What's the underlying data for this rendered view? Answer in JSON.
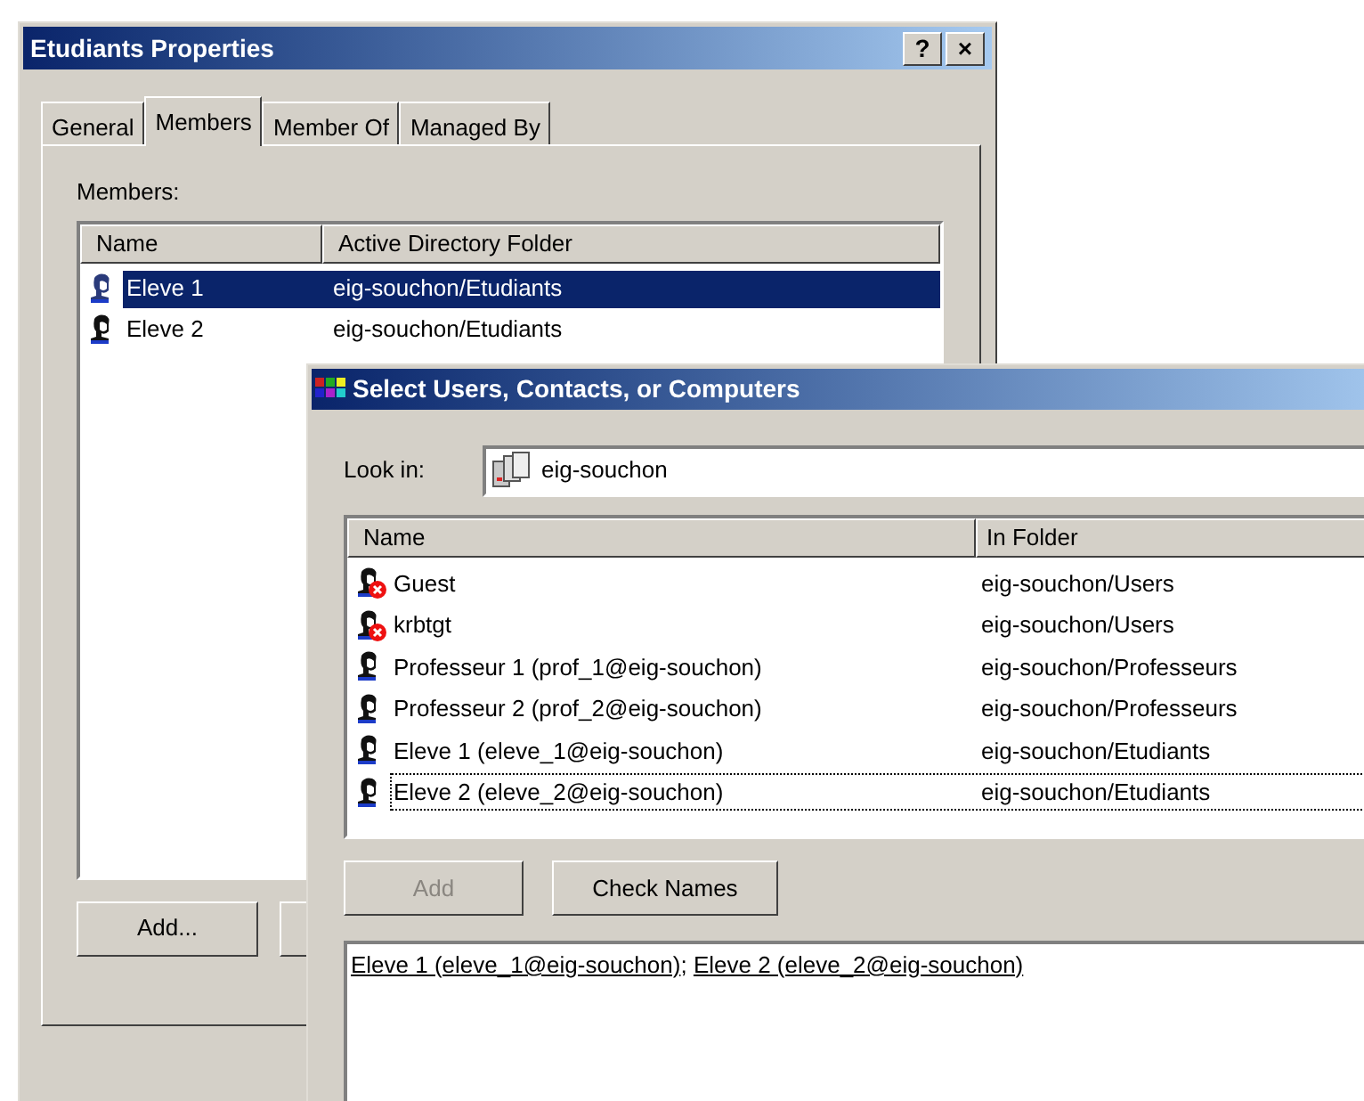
{
  "properties_window": {
    "title": "Etudiants Properties",
    "title_buttons": [
      "?",
      "×"
    ],
    "tabs": [
      {
        "label": "General",
        "selected": false
      },
      {
        "label": "Members",
        "selected": true
      },
      {
        "label": "Member Of",
        "selected": false
      },
      {
        "label": "Managed By",
        "selected": false
      }
    ],
    "members_label": "Members:",
    "columns": [
      "Name",
      "Active Directory Folder"
    ],
    "rows": [
      {
        "name": "Eleve 1",
        "folder": "eig-souchon/Etudiants",
        "kind": "user",
        "selected": true
      },
      {
        "name": "Eleve 2",
        "folder": "eig-souchon/Etudiants",
        "kind": "user",
        "selected": false
      }
    ],
    "buttons": [
      {
        "label": "Add...",
        "disabled": false
      }
    ]
  },
  "select_dialog": {
    "title": "Select Users, Contacts, or Computers",
    "look_in_label": "Look in:",
    "look_in_value": "eig-souchon",
    "columns": [
      "Name",
      "In Folder"
    ],
    "rows": [
      {
        "name": "Guest",
        "folder": "eig-souchon/Users",
        "kind": "disabled_user",
        "focused": false
      },
      {
        "name": "krbtgt",
        "folder": "eig-souchon/Users",
        "kind": "disabled_user",
        "focused": false
      },
      {
        "name": "Professeur 1 (prof_1@eig-souchon)",
        "folder": "eig-souchon/Professeurs",
        "kind": "user",
        "focused": false
      },
      {
        "name": "Professeur 2 (prof_2@eig-souchon)",
        "folder": "eig-souchon/Professeurs",
        "kind": "user",
        "focused": false
      },
      {
        "name": "Eleve 1 (eleve_1@eig-souchon)",
        "folder": "eig-souchon/Etudiants",
        "kind": "user",
        "focused": false
      },
      {
        "name": "Eleve 2 (eleve_2@eig-souchon)",
        "folder": "eig-souchon/Etudiants",
        "kind": "user",
        "focused": true
      }
    ],
    "buttons": [
      {
        "label": "Add",
        "disabled": true
      },
      {
        "label": "Check Names",
        "disabled": false
      }
    ],
    "selection": {
      "separator": "; ",
      "names": [
        {
          "text": "Eleve 1 (eleve_1@eig-souchon)",
          "resolved": true
        },
        {
          "text": "Eleve 2 (eleve_2@eig-souchon)",
          "resolved": true
        }
      ]
    }
  }
}
